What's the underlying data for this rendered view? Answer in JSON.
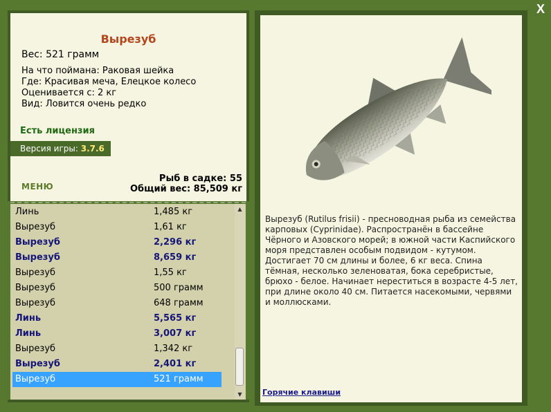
{
  "window": {
    "close_label": "X"
  },
  "fish": {
    "name": "Вырезуб",
    "weight": "Вес: 521 грамм",
    "bait": "На что поймана: Раковая шейка",
    "location": "Где: Красивая меча, Елецкое колесо",
    "valued_from": "Оценивается с: 2 кг",
    "kind": "Вид: Ловится очень редко"
  },
  "license": "Есть лицензия",
  "version": {
    "label": "Версия игры:",
    "value": "3.7.6"
  },
  "menu_label": "МЕНЮ",
  "cage": {
    "count": "Рыб в садке: 55",
    "total": "Общий вес: 85,509 кг"
  },
  "catches": [
    {
      "name": "Линь",
      "weight": "1,485 кг",
      "bold": false
    },
    {
      "name": "Вырезуб",
      "weight": "1,61 кг",
      "bold": false
    },
    {
      "name": "Вырезуб",
      "weight": "2,296 кг",
      "bold": true
    },
    {
      "name": "Вырезуб",
      "weight": "8,659 кг",
      "bold": true
    },
    {
      "name": "Вырезуб",
      "weight": "1,55 кг",
      "bold": false
    },
    {
      "name": "Вырезуб",
      "weight": "500 грамм",
      "bold": false
    },
    {
      "name": "Вырезуб",
      "weight": "648 грамм",
      "bold": false
    },
    {
      "name": "Линь",
      "weight": "5,565 кг",
      "bold": true
    },
    {
      "name": "Линь",
      "weight": "3,007 кг",
      "bold": true
    },
    {
      "name": "Вырезуб",
      "weight": "1,342 кг",
      "bold": false
    },
    {
      "name": "Вырезуб",
      "weight": "2,401 кг",
      "bold": true
    },
    {
      "name": "Вырезуб",
      "weight": "521 грамм",
      "bold": false,
      "selected": true
    }
  ],
  "description": "Вырезуб (Rutilus frisii) - пресноводная рыба из семейства карповых (Cyprinidae). Распространён в бассейне Чёрного и Азовского морей; в южной части Каспийского моря представлен особым подвидом - кутумом. Достигает 70 см длины и более, 6 кг веса. Спина тёмная, несколько зеленоватая, бока серебристые, брюхо - белое. Начинает нереститься в возрасте 4-5 лет, при длине около 40 см. Питается насекомыми, червями и моллюсками.",
  "hotkeys_label": "Горячие клавиши",
  "colors": {
    "background": "#56792f",
    "panel": "#f6f5e1",
    "list_bg": "#d3d1ab",
    "title": "#b3471e",
    "license": "#1f6a12",
    "bold_row": "#16167a",
    "selected_row": "#38a2ff"
  }
}
